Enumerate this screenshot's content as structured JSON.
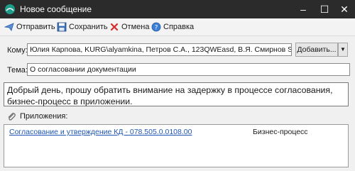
{
  "window": {
    "title": "Новое сообщение",
    "icon": "app-logo-icon"
  },
  "toolbar": {
    "send_label": "Отправить",
    "save_label": "Сохранить",
    "cancel_label": "Отмена",
    "help_label": "Справка"
  },
  "recipients": {
    "label": "Кому:",
    "value": "Юлия Карпова, KURG\\alyamkina, Петров С.А., 123QWEasd, В.Я. Смирнов    Smirr",
    "add_button_label": "Добавить..."
  },
  "subject": {
    "label": "Тема:",
    "value": "О согласовании документации"
  },
  "message": {
    "body": "Добрый день, прошу обратить внимание на задержку в процессе согласования, бизнес-процесс в приложении."
  },
  "attachments": {
    "label": "Приложения:",
    "items": [
      {
        "name": "Согласование и утверждение КД - 078.505.0.0108.00",
        "type": "Бизнес-процесс"
      }
    ]
  }
}
